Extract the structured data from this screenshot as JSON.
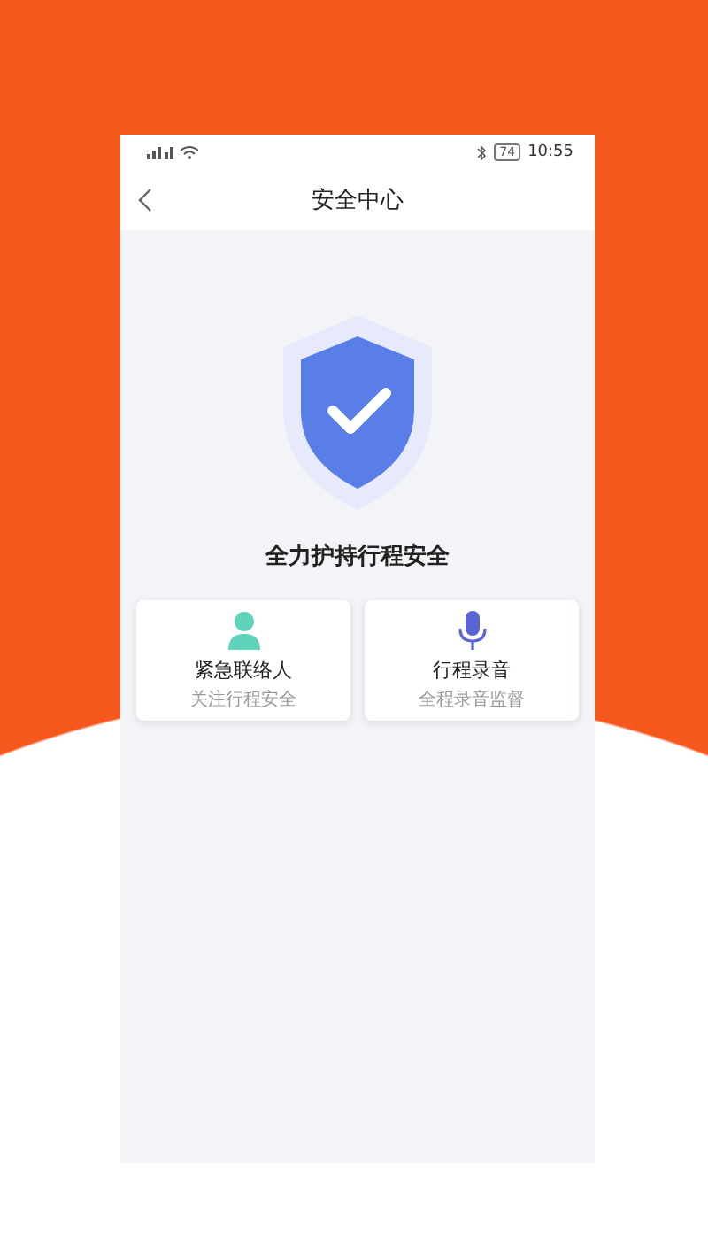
{
  "status_bar": {
    "time": "10:55",
    "battery": "74"
  },
  "header": {
    "title": "安全中心"
  },
  "hero": {
    "slogan": "全力护持行程安全"
  },
  "cards": [
    {
      "kind": "contact",
      "title": "紧急联络人",
      "subtitle": "关注行程安全"
    },
    {
      "kind": "recording",
      "title": "行程录音",
      "subtitle": "全程录音监督"
    }
  ]
}
